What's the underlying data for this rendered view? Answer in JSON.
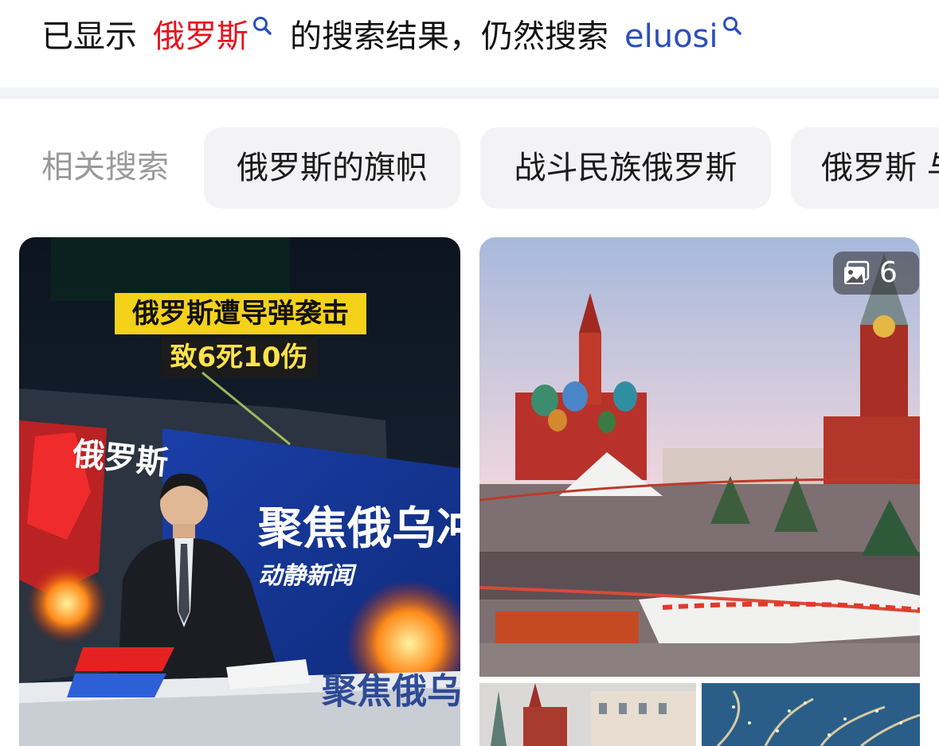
{
  "correction": {
    "prefix": "已显示",
    "corrected_term": "俄罗斯",
    "middle": "的搜索结果，仍然搜索",
    "original_term": "eluosi"
  },
  "related": {
    "label": "相关搜索",
    "chips": [
      "俄罗斯的旗帜",
      "战斗民族俄罗斯",
      "俄罗斯 与"
    ]
  },
  "results": {
    "news_image": {
      "headline_line1": "俄罗斯遭导弹袭击",
      "headline_line2": "致6死10伤",
      "map_label": "俄罗斯",
      "screen_title": "聚焦俄乌冲",
      "channel_logo": "动静新闻",
      "desk_text": "聚焦俄乌冲"
    },
    "gallery": {
      "photo_count": "6"
    }
  },
  "colors": {
    "highlight_red": "#e5141e",
    "link_blue": "#2a4ebd",
    "chip_bg": "#f3f3f5"
  },
  "icons": {
    "search_small": "magnifier-icon",
    "gallery": "images-stack-icon"
  }
}
